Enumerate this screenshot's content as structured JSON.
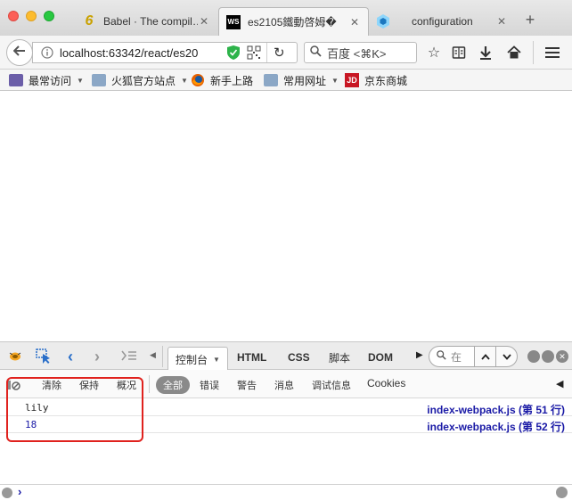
{
  "tabs": [
    {
      "title": "Babel · The compil…",
      "favicon": "6",
      "close": "✕"
    },
    {
      "title": "es2105鐵動啓姆�",
      "favicon": "WS",
      "close": "✕"
    },
    {
      "title": "configuration",
      "favicon": "",
      "close": "✕"
    }
  ],
  "new_tab": "+",
  "address": {
    "url": "localhost:63342/react/es20"
  },
  "search": {
    "placeholder": "百度 <⌘K>"
  },
  "bookmarks": [
    {
      "label": "最常访问",
      "caret": "▼"
    },
    {
      "label": "火狐官方站点",
      "caret": "▼"
    },
    {
      "label": "新手上路",
      "caret": ""
    },
    {
      "label": "常用网址",
      "caret": "▼"
    },
    {
      "label": "京东商城",
      "caret": ""
    }
  ],
  "bookmark_jd_logo": "JD",
  "devtools": {
    "tabs": [
      "控制台",
      "HTML",
      "CSS",
      "脚本",
      "DOM"
    ],
    "console_search_placeholder": "在",
    "filters": [
      "全部",
      "错误",
      "警告",
      "消息",
      "调试信息",
      "Cookies"
    ],
    "clear_label": "清除",
    "persist_label": "保持",
    "profile_label": "概况",
    "logs": [
      {
        "value": "lily",
        "source": "index-webpack.js (第 51 行)",
        "color": "#222222"
      },
      {
        "value": "18",
        "source": "index-webpack.js (第 52 行)",
        "color": "#1a1aa6"
      }
    ],
    "prompt": "›"
  },
  "colors": {
    "highlight": "#e0221e",
    "accent": "#1a1aa6"
  }
}
